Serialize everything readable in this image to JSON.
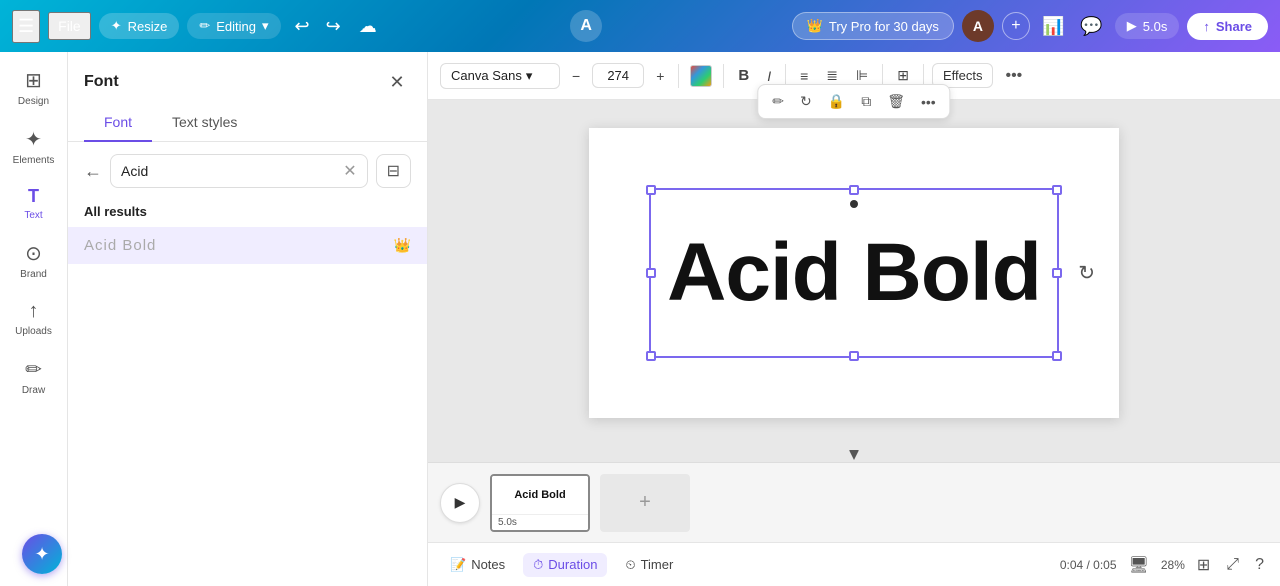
{
  "navbar": {
    "menu_icon": "☰",
    "file_label": "File",
    "resize_label": "Resize",
    "editing_label": "Editing",
    "undo_icon": "↩",
    "redo_icon": "↪",
    "magic_icon": "☁",
    "center_a": "A",
    "pro_crown": "👑",
    "pro_label": "Try Pro for 30 days",
    "avatar_label": "A",
    "plus_label": "+",
    "stats_icon": "📊",
    "chat_icon": "💬",
    "play_label": "▶",
    "play_time": "5.0s",
    "share_icon": "↑",
    "share_label": "Share"
  },
  "sidebar": {
    "items": [
      {
        "icon": "⊞",
        "label": "Design"
      },
      {
        "icon": "✦",
        "label": "Elements"
      },
      {
        "icon": "T",
        "label": "Text"
      },
      {
        "icon": "⊙",
        "label": "Brand"
      },
      {
        "icon": "↑",
        "label": "Uploads"
      },
      {
        "icon": "✏",
        "label": "Draw"
      }
    ]
  },
  "font_panel": {
    "title": "Font",
    "close_icon": "✕",
    "tab_font": "Font",
    "tab_text_styles": "Text styles",
    "back_icon": "←",
    "search_value": "Acid",
    "clear_icon": "✕",
    "filter_icon": "⊟",
    "results_label": "All results",
    "results": [
      {
        "name": "Acid Bold",
        "crown": "👑"
      }
    ]
  },
  "toolbar": {
    "font_name": "Canva Sans",
    "font_dropdown": "▾",
    "minus_icon": "−",
    "font_size": "274",
    "plus_icon": "+",
    "bold_icon": "B",
    "italic_icon": "I",
    "align_left_icon": "≡",
    "align_center_icon": "≣",
    "align_right_icon": "⊫",
    "grid_icon": "⊞",
    "effects_label": "Effects",
    "more_icon": "•••"
  },
  "canvas": {
    "text_content": "Acid Bold",
    "selection_toolbar": {
      "edit_icon": "✏",
      "refresh_icon": "↻",
      "lock_icon": "🔒",
      "copy_icon": "⊞",
      "delete_icon": "🗑",
      "more_icon": "•••"
    }
  },
  "timeline": {
    "play_icon": "▶",
    "clip_label": "Acid Bold",
    "clip_time": "5.0s",
    "add_icon": "+"
  },
  "bottom_bar": {
    "notes_icon": "📝",
    "notes_label": "Notes",
    "duration_icon": "⏱",
    "duration_label": "Duration",
    "timer_icon": "⏲",
    "timer_label": "Timer",
    "time_display": "0:04 / 0:05",
    "monitor_icon": "🖥",
    "zoom_value": "28%",
    "grid_icon": "⊞",
    "fullscreen_icon": "⤢",
    "help_icon": "?"
  }
}
